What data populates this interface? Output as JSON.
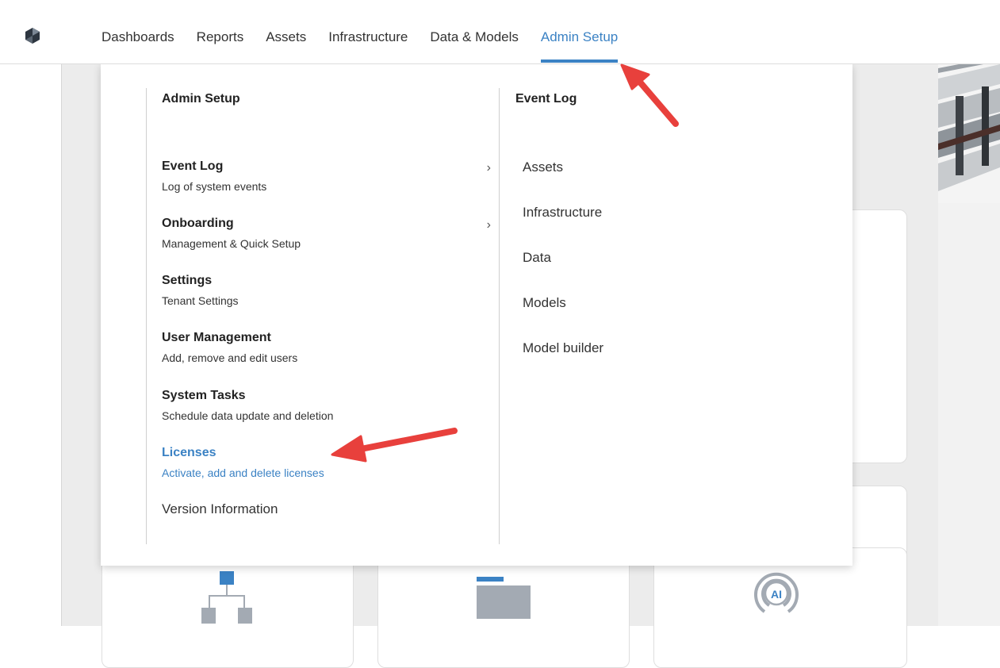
{
  "nav": {
    "items": [
      "Dashboards",
      "Reports",
      "Assets",
      "Infrastructure",
      "Data & Models",
      "Admin Setup"
    ],
    "active_index": 5
  },
  "dropdown": {
    "left_title": "Admin Setup",
    "right_title": "Event Log",
    "items": [
      {
        "title": "Event Log",
        "desc": "Log of system events",
        "has_chevron": true
      },
      {
        "title": "Onboarding",
        "desc": "Management & Quick Setup",
        "has_chevron": true
      },
      {
        "title": "Settings",
        "desc": "Tenant Settings"
      },
      {
        "title": "User Management",
        "desc": "Add, remove and edit users"
      },
      {
        "title": "System Tasks",
        "desc": "Schedule data update and deletion"
      },
      {
        "title": "Licenses",
        "desc": "Activate, add and delete licenses",
        "active": true
      }
    ],
    "version_label": "Version Information",
    "sub_items": [
      "Assets",
      "Infrastructure",
      "Data",
      "Models",
      "Model builder"
    ],
    "chevron_glyph": "›"
  },
  "icons": {
    "logo": "logo-icon",
    "card_icons": [
      "hierarchy-icon",
      "folder-icon",
      "ai-icon"
    ],
    "ai_text": "AI"
  },
  "colors": {
    "accent": "#3b82c4",
    "annotation_arrow": "#e8403c",
    "icon_gray": "#a3aab3"
  }
}
